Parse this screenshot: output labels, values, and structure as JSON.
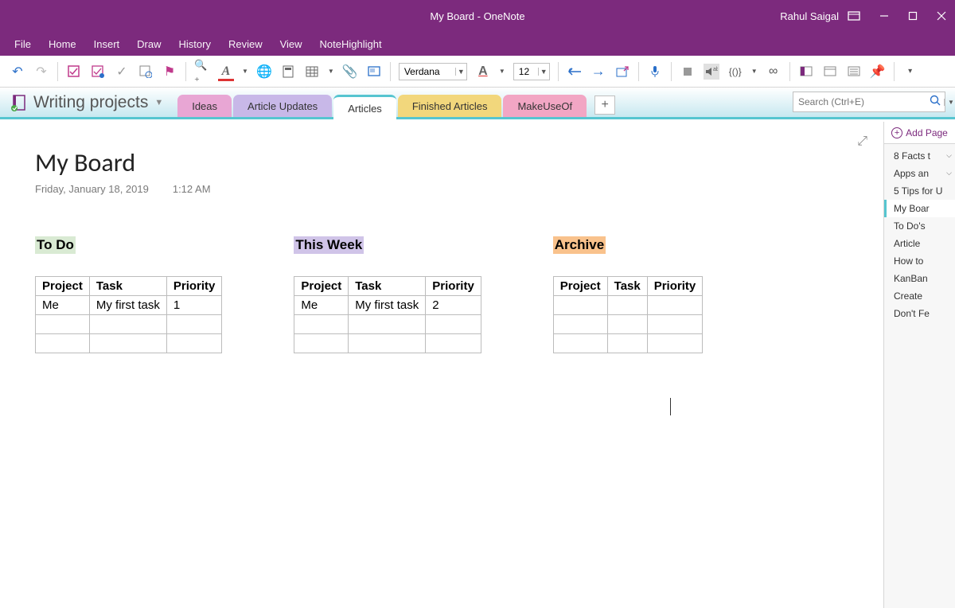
{
  "title": "My Board  -  OneNote",
  "user": "Rahul Saigal",
  "menu": [
    "File",
    "Home",
    "Insert",
    "Draw",
    "History",
    "Review",
    "View",
    "NoteHighlight"
  ],
  "ribbon": {
    "font_name": "Verdana",
    "font_size": "12"
  },
  "notebook": "Writing projects",
  "section_tabs": [
    {
      "label": "Ideas",
      "style": "pink"
    },
    {
      "label": "Article Updates",
      "style": "lav"
    },
    {
      "label": "Articles",
      "style": "act2"
    },
    {
      "label": "Finished Articles",
      "style": "yellow"
    },
    {
      "label": "MakeUseOf",
      "style": "pink2"
    }
  ],
  "search_placeholder": "Search (Ctrl+E)",
  "page": {
    "title": "My Board",
    "date": "Friday, January 18, 2019",
    "time": "1:12 AM"
  },
  "columns": [
    {
      "name": "To Do",
      "hclass": "h-green",
      "headers": [
        "Project",
        "Task",
        "Priority"
      ],
      "rows": [
        [
          "Me",
          "My first task",
          "1"
        ],
        [
          "",
          "",
          ""
        ],
        [
          "",
          "",
          ""
        ]
      ]
    },
    {
      "name": "This Week",
      "hclass": "h-purple",
      "headers": [
        "Project",
        "Task",
        "Priority"
      ],
      "rows": [
        [
          "Me",
          "My first task",
          "2"
        ],
        [
          "",
          "",
          ""
        ],
        [
          "",
          "",
          ""
        ]
      ]
    },
    {
      "name": "Archive",
      "hclass": "h-orange",
      "headers": [
        "Project",
        "Task",
        "Priority"
      ],
      "rows": [
        [
          "",
          "",
          ""
        ],
        [
          "",
          "",
          ""
        ],
        [
          "",
          "",
          ""
        ]
      ]
    }
  ],
  "add_page_label": "Add Page",
  "page_list": [
    {
      "label": "8 Facts t",
      "chev": true
    },
    {
      "label": "Apps an",
      "chev": true
    },
    {
      "label": "5 Tips for U"
    },
    {
      "label": "My Boar",
      "sel": true
    },
    {
      "label": "To Do's"
    },
    {
      "label": "Article"
    },
    {
      "label": "How to"
    },
    {
      "label": "KanBan"
    },
    {
      "label": "Create"
    },
    {
      "label": "Don't Fe"
    }
  ]
}
